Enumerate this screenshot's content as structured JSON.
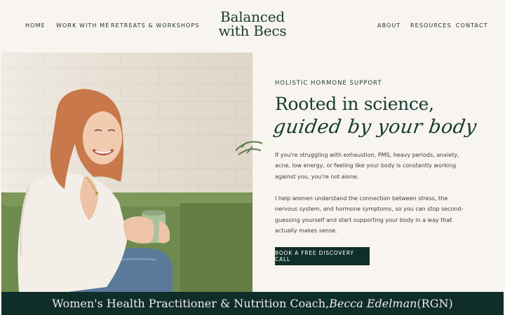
{
  "nav": {
    "left": [
      "HOME",
      "WORK WITH ME",
      "RETREATS & WORKSHOPS"
    ],
    "right": [
      "ABOUT",
      "RESOURCES",
      "CONTACT"
    ]
  },
  "logo": {
    "line1": "Balanced",
    "line2": "with Becs"
  },
  "hero": {
    "eyebrow": "HOLISTIC HORMONE SUPPORT",
    "headline": "Rooted in science,",
    "script": "guided by your body",
    "para1": "If you're struggling with exhaustion, PMS, heavy periods, anxiety, acne, low energy, or feeling like your body is constantly working against you, you're not alone.",
    "para2": "I help women understand the connection between stress, the nervous system, and hormone symptoms, so you can stop second-guessing yourself and start supporting your body in a way that actually makes sense.",
    "cta": "BOOK A FREE DISCOVERY CALL"
  },
  "banner": {
    "prefix": "Women's Health Practitioner & Nutrition Coach, ",
    "name": "Becca Edelman",
    "suffix": " (RGN)"
  },
  "colors": {
    "background": "#f8f4ef",
    "brand_dark": "#0f2d29",
    "accent_green": "#6f8a4e"
  }
}
